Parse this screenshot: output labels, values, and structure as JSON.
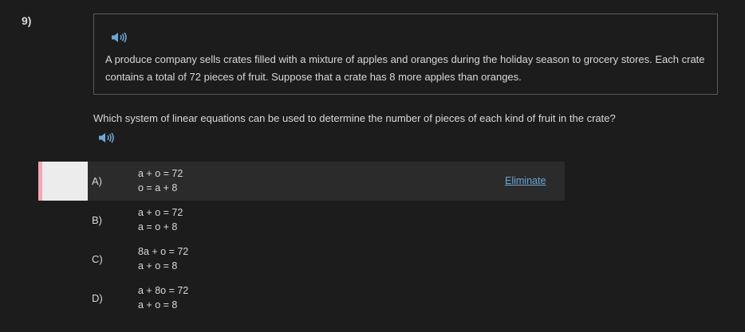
{
  "question": {
    "number": "9)",
    "passage": "A produce company sells crates filled with a mixture of apples and oranges during the holiday season to grocery stores. Each crate contains a total of 72 pieces of fruit. Suppose that a crate has 8 more apples than oranges.",
    "prompt": "Which system of linear equations can be used to determine the number of pieces of each kind of fruit in the crate?"
  },
  "icons": {
    "audio": "speaker-icon",
    "audio_color": "#6ba7d8"
  },
  "choices": [
    {
      "letter": "A)",
      "eq1": "a + o = 72",
      "eq2": "o = a + 8",
      "selected": true,
      "eliminate_label": "Eliminate"
    },
    {
      "letter": "B)",
      "eq1": "a + o = 72",
      "eq2": "a = o + 8",
      "selected": false
    },
    {
      "letter": "C)",
      "eq1": "8a + o = 72",
      "eq2": "a + o = 8",
      "selected": false
    },
    {
      "letter": "D)",
      "eq1": "a + 8o = 72",
      "eq2": "a + o = 8",
      "selected": false
    }
  ],
  "colors": {
    "background": "#1c1c1c",
    "text": "#d8d8d8",
    "link": "#6ba7d8",
    "selected_row": "#2b2b2b",
    "marker_accent": "#f4a7b6"
  }
}
